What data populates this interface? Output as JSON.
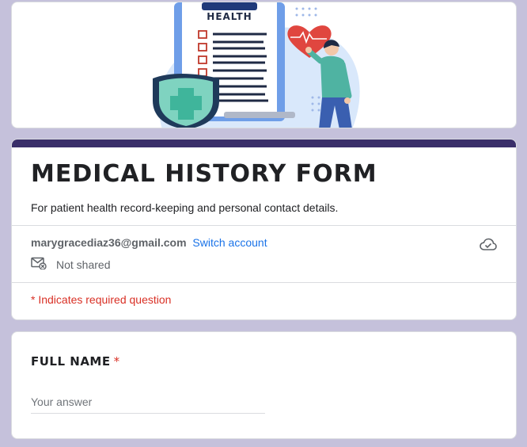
{
  "banner": {
    "clipboard_title": "HEALTH"
  },
  "form": {
    "title": "MEDICAL HISTORY FORM",
    "description": "For patient health record-keeping and personal contact details.",
    "accent_color": "#3a2f6a"
  },
  "account": {
    "email": "marygracediaz36@gmail.com",
    "switch_label": "Switch account",
    "not_shared_label": "Not shared"
  },
  "required_note": "* Indicates required question",
  "questions": [
    {
      "title": "FULL NAME",
      "required_mark": "*",
      "placeholder": "Your answer"
    }
  ],
  "icons": {
    "cloud": "cloud-check-icon",
    "mail": "mail-not-shared-icon"
  }
}
